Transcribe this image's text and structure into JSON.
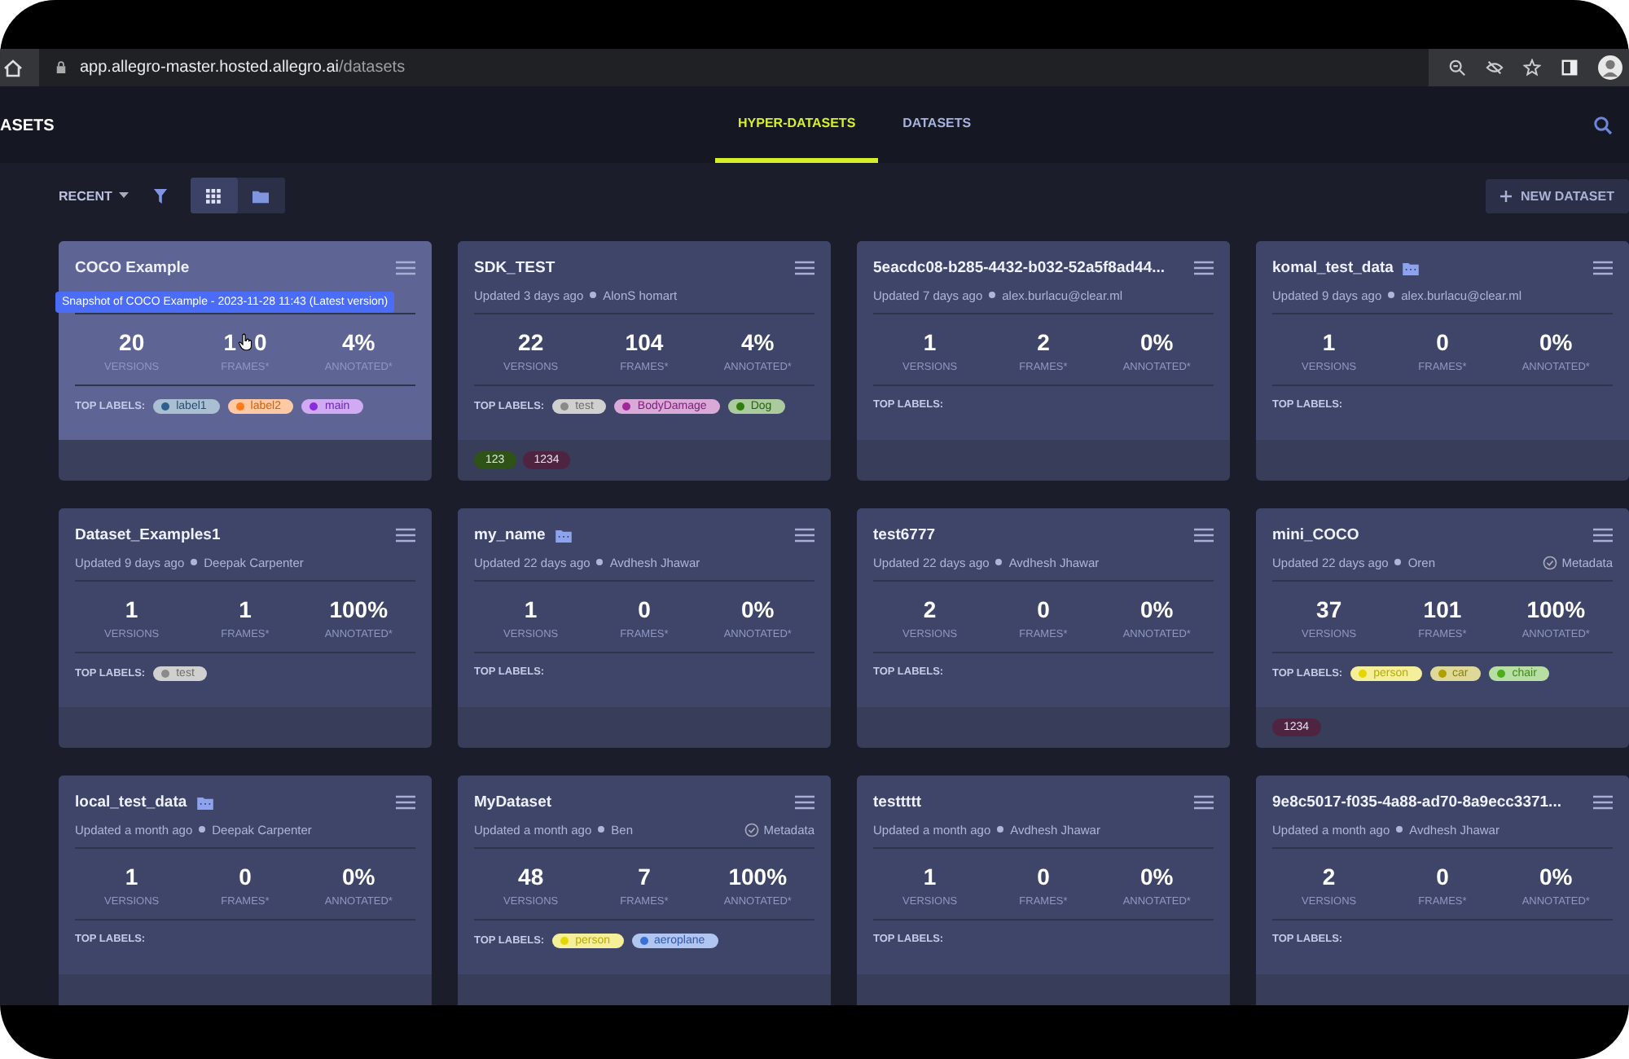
{
  "browser": {
    "url_host": "app.allegro-master.hosted.allegro.ai",
    "url_path": "/datasets"
  },
  "header": {
    "title": "ASETS",
    "tabs": [
      {
        "label": "HYPER-DATASETS",
        "selected": true
      },
      {
        "label": "DATASETS",
        "selected": false
      }
    ]
  },
  "toolbar": {
    "sort": "RECENT",
    "views": [
      {
        "kind": "grid",
        "selected": true
      },
      {
        "kind": "folder",
        "selected": false
      }
    ],
    "new_button": "NEW DATASET"
  },
  "cards": [
    {
      "name": "COCO Example",
      "folder": false,
      "hovered": true,
      "tooltip": "Snapshot of COCO Example - 2023-11-28 11:43 (Latest version)",
      "stats": [
        {
          "value": "20",
          "label": "VERSIONS"
        },
        {
          "value": "1 0",
          "label": "FRAMES*"
        },
        {
          "value": "4%",
          "label": "ANNOTATED*"
        }
      ],
      "labels_title": "TOP LABELS:",
      "labels": [
        {
          "text": "label1",
          "color": "#2e5f8f"
        },
        {
          "text": "label2",
          "color": "#ff7a1a"
        },
        {
          "text": "main",
          "color": "#8a2be2"
        }
      ]
    },
    {
      "name": "SDK_TEST",
      "folder": false,
      "hovered": false,
      "updated": "Updated 3 days ago",
      "author": "AlonS homart",
      "stats": [
        {
          "value": "22",
          "label": "VERSIONS"
        },
        {
          "value": "104",
          "label": "FRAMES*"
        },
        {
          "value": "4%",
          "label": "ANNOTATED*"
        }
      ],
      "labels_title": "TOP LABELS:",
      "labels": [
        {
          "text": "test",
          "color": "#8a8a8a"
        },
        {
          "text": "BodyDamage",
          "color": "#a0289a"
        },
        {
          "text": "Dog",
          "color": "#2e7d0e"
        }
      ],
      "versions": [
        {
          "text": "123",
          "color": "#2f5216"
        },
        {
          "text": "1234",
          "color": "#4f2440"
        }
      ]
    },
    {
      "name": "5eacdc08-b285-4432-b032-52a5f8ad44...",
      "folder": false,
      "hovered": false,
      "updated": "Updated 7 days ago",
      "author": "alex.burlacu@clear.ml",
      "stats": [
        {
          "value": "1",
          "label": "VERSIONS"
        },
        {
          "value": "2",
          "label": "FRAMES*"
        },
        {
          "value": "0%",
          "label": "ANNOTATED*"
        }
      ],
      "labels_title": "TOP LABELS:"
    },
    {
      "name": "komal_test_data",
      "folder": true,
      "hovered": false,
      "updated": "Updated 9 days ago",
      "author": "alex.burlacu@clear.ml",
      "stats": [
        {
          "value": "1",
          "label": "VERSIONS"
        },
        {
          "value": "0",
          "label": "FRAMES*"
        },
        {
          "value": "0%",
          "label": "ANNOTATED*"
        }
      ],
      "labels_title": "TOP LABELS:"
    },
    {
      "name": "Dataset_Examples1",
      "folder": false,
      "hovered": false,
      "updated": "Updated 9 days ago",
      "author": "Deepak Carpenter",
      "stats": [
        {
          "value": "1",
          "label": "VERSIONS"
        },
        {
          "value": "1",
          "label": "FRAMES*"
        },
        {
          "value": "100%",
          "label": "ANNOTATED*"
        }
      ],
      "labels_title": "TOP LABELS:",
      "labels": [
        {
          "text": "test",
          "color": "#8a8a8a"
        }
      ]
    },
    {
      "name": "my_name",
      "folder": true,
      "hovered": false,
      "updated": "Updated 22 days ago",
      "author": "Avdhesh Jhawar",
      "stats": [
        {
          "value": "1",
          "label": "VERSIONS"
        },
        {
          "value": "0",
          "label": "FRAMES*"
        },
        {
          "value": "0%",
          "label": "ANNOTATED*"
        }
      ],
      "labels_title": "TOP LABELS:"
    },
    {
      "name": "test6777",
      "folder": false,
      "hovered": false,
      "updated": "Updated 22 days ago",
      "author": "Avdhesh Jhawar",
      "stats": [
        {
          "value": "2",
          "label": "VERSIONS"
        },
        {
          "value": "0",
          "label": "FRAMES*"
        },
        {
          "value": "0%",
          "label": "ANNOTATED*"
        }
      ],
      "labels_title": "TOP LABELS:"
    },
    {
      "name": "mini_COCO",
      "folder": false,
      "hovered": false,
      "updated": "Updated 22 days ago",
      "author": "Oren",
      "metadata": "Metadata",
      "stats": [
        {
          "value": "37",
          "label": "VERSIONS"
        },
        {
          "value": "101",
          "label": "FRAMES*"
        },
        {
          "value": "100%",
          "label": "ANNOTATED*"
        }
      ],
      "labels_title": "TOP LABELS:",
      "labels": [
        {
          "text": "person",
          "color": "#e6d600"
        },
        {
          "text": "car",
          "color": "#b0a000"
        },
        {
          "text": "chair",
          "color": "#4cae1a"
        }
      ],
      "versions": [
        {
          "text": "1234",
          "color": "#4f2440"
        }
      ]
    },
    {
      "name": "local_test_data",
      "folder": true,
      "hovered": false,
      "updated": "Updated a month ago",
      "author": "Deepak Carpenter",
      "stats": [
        {
          "value": "1",
          "label": "VERSIONS"
        },
        {
          "value": "0",
          "label": "FRAMES*"
        },
        {
          "value": "0%",
          "label": "ANNOTATED*"
        }
      ],
      "labels_title": "TOP LABELS:"
    },
    {
      "name": "MyDataset",
      "folder": false,
      "hovered": false,
      "updated": "Updated a month ago",
      "author": "Ben",
      "metadata": "Metadata",
      "stats": [
        {
          "value": "48",
          "label": "VERSIONS"
        },
        {
          "value": "7",
          "label": "FRAMES*"
        },
        {
          "value": "100%",
          "label": "ANNOTATED*"
        }
      ],
      "labels_title": "TOP LABELS:",
      "labels": [
        {
          "text": "person",
          "color": "#e6d600"
        },
        {
          "text": "aeroplane",
          "color": "#3a6fd8"
        }
      ]
    },
    {
      "name": "testtttt",
      "folder": false,
      "hovered": false,
      "updated": "Updated a month ago",
      "author": "Avdhesh Jhawar",
      "stats": [
        {
          "value": "1",
          "label": "VERSIONS"
        },
        {
          "value": "0",
          "label": "FRAMES*"
        },
        {
          "value": "0%",
          "label": "ANNOTATED*"
        }
      ],
      "labels_title": "TOP LABELS:"
    },
    {
      "name": "9e8c5017-f035-4a88-ad70-8a9ecc3371...",
      "folder": false,
      "hovered": false,
      "updated": "Updated a month ago",
      "author": "Avdhesh Jhawar",
      "stats": [
        {
          "value": "2",
          "label": "VERSIONS"
        },
        {
          "value": "0",
          "label": "FRAMES*"
        },
        {
          "value": "0%",
          "label": "ANNOTATED*"
        }
      ],
      "labels_title": "TOP LABELS:"
    }
  ]
}
